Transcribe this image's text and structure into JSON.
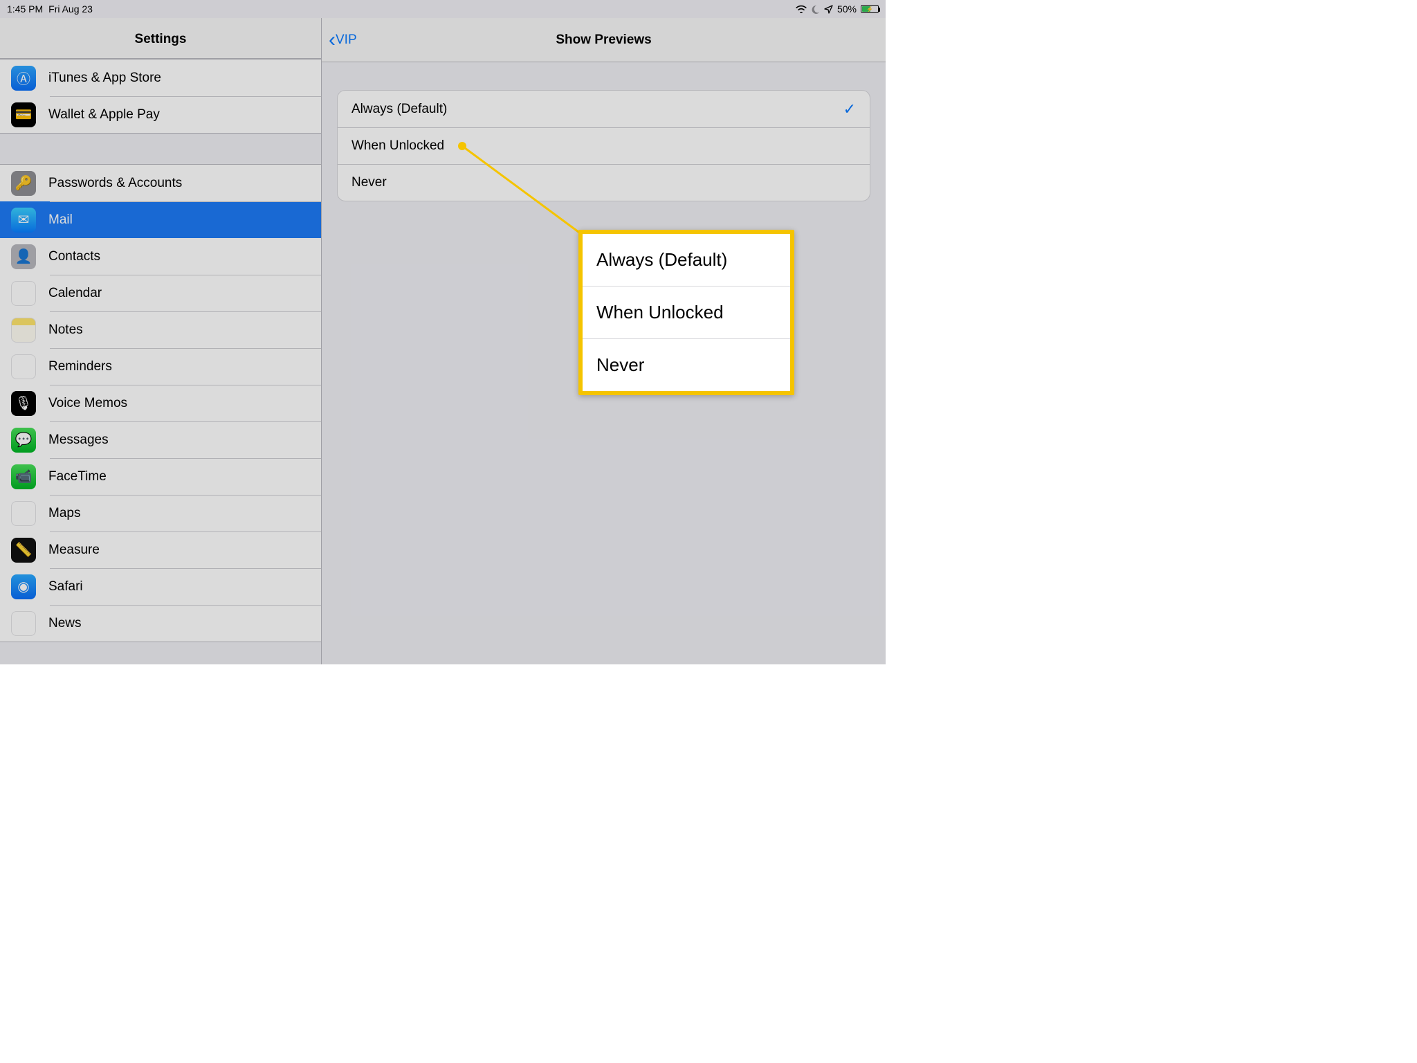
{
  "statusbar": {
    "time": "1:45 PM",
    "date": "Fri Aug 23",
    "battery_pct": "50%"
  },
  "sidebar": {
    "title": "Settings",
    "group1": [
      {
        "label": "iTunes & App Store",
        "icon": "appstore"
      },
      {
        "label": "Wallet & Apple Pay",
        "icon": "wallet"
      }
    ],
    "group2": [
      {
        "label": "Passwords & Accounts",
        "icon": "passwords"
      },
      {
        "label": "Mail",
        "icon": "mail",
        "selected": true
      },
      {
        "label": "Contacts",
        "icon": "contacts"
      },
      {
        "label": "Calendar",
        "icon": "calendar"
      },
      {
        "label": "Notes",
        "icon": "notes"
      },
      {
        "label": "Reminders",
        "icon": "reminders"
      },
      {
        "label": "Voice Memos",
        "icon": "voice"
      },
      {
        "label": "Messages",
        "icon": "messages"
      },
      {
        "label": "FaceTime",
        "icon": "facetime"
      },
      {
        "label": "Maps",
        "icon": "maps"
      },
      {
        "label": "Measure",
        "icon": "measure"
      },
      {
        "label": "Safari",
        "icon": "safari"
      },
      {
        "label": "News",
        "icon": "news"
      }
    ]
  },
  "detail": {
    "back_label": "VIP",
    "title": "Show Previews",
    "options": [
      {
        "label": "Always (Default)",
        "selected": true
      },
      {
        "label": "When Unlocked"
      },
      {
        "label": "Never"
      }
    ]
  },
  "callout": {
    "items": [
      "Always (Default)",
      "When Unlocked",
      "Never"
    ]
  }
}
